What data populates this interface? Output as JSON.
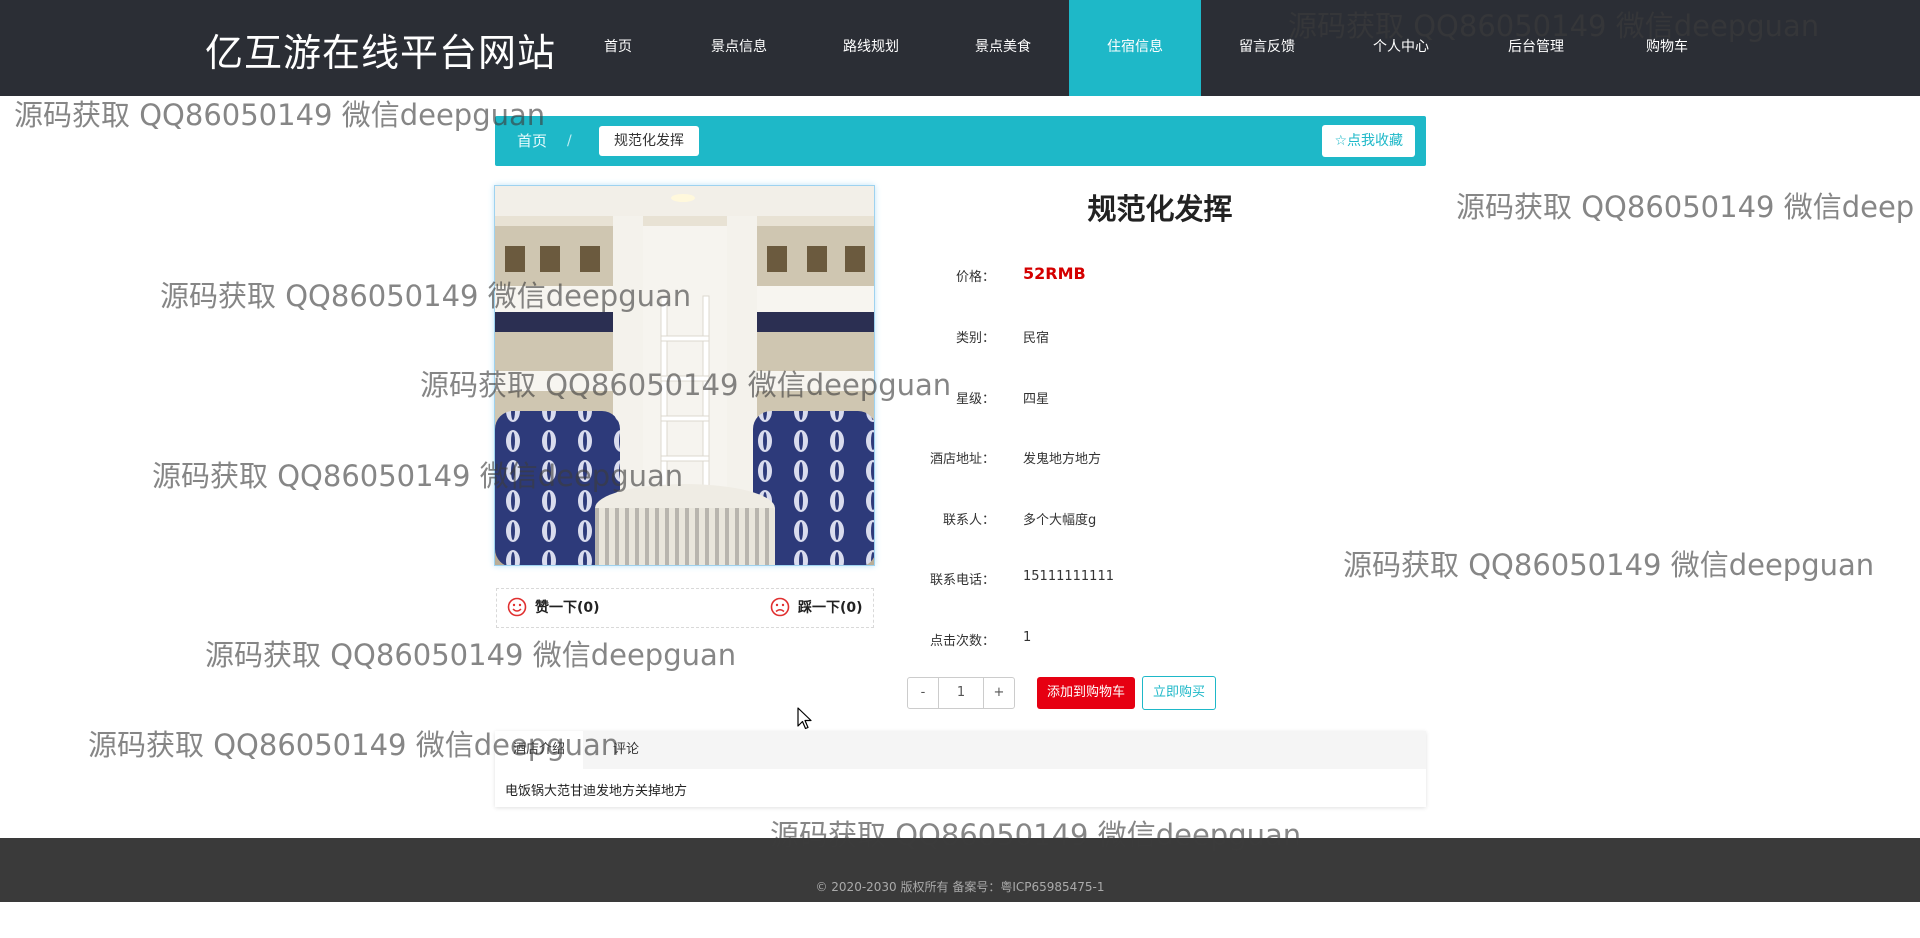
{
  "header": {
    "brand": "亿互游在线平台网站",
    "nav": [
      {
        "label": "首页",
        "active": false
      },
      {
        "label": "景点信息",
        "active": false
      },
      {
        "label": "路线规划",
        "active": false
      },
      {
        "label": "景点美食",
        "active": false
      },
      {
        "label": "住宿信息",
        "active": true
      },
      {
        "label": "留言反馈",
        "active": false
      },
      {
        "label": "个人中心",
        "active": false
      },
      {
        "label": "后台管理",
        "active": false
      },
      {
        "label": "购物车",
        "active": false
      }
    ]
  },
  "breadcrumb": {
    "home": "首页",
    "separator": "/",
    "current": "规范化发挥",
    "favorite_label": "☆点我收藏"
  },
  "votes": {
    "like_label": "赞一下(0)",
    "dislike_label": "踩一下(0)"
  },
  "detail": {
    "title": "规范化发挥",
    "rows": [
      {
        "label": "价格：",
        "value": "52RMB"
      },
      {
        "label": "类别：",
        "value": "民宿"
      },
      {
        "label": "星级：",
        "value": "四星"
      },
      {
        "label": "酒店地址：",
        "value": "发鬼地方地方"
      },
      {
        "label": "联系人：",
        "value": "多个大幅度g"
      },
      {
        "label": "联系电话：",
        "value": "15111111111"
      },
      {
        "label": "点击次数：",
        "value": "1"
      }
    ]
  },
  "purchase": {
    "minus": "-",
    "quantity": "1",
    "plus": "+",
    "add_to_cart": "添加到购物车",
    "buy_now": "立即购买"
  },
  "tabs": {
    "items": [
      {
        "label": "酒店介绍",
        "active": true
      },
      {
        "label": "评论",
        "active": false
      }
    ],
    "content": "电饭锅大范甘迪发地方关掉地方"
  },
  "footer": {
    "text": "© 2020-2030 版权所有 备案号：粤ICP65985475-1"
  },
  "watermark": {
    "text": "源码获取 QQ86050149 微信deepguan",
    "text_truncated": "源码获取 QQ86050149 微信deep"
  },
  "colors": {
    "topbar": "#2b2e35",
    "accent": "#1eb8c8",
    "price": "#d40000",
    "cart_button": "#e60012",
    "footer": "#3a3a3a"
  }
}
